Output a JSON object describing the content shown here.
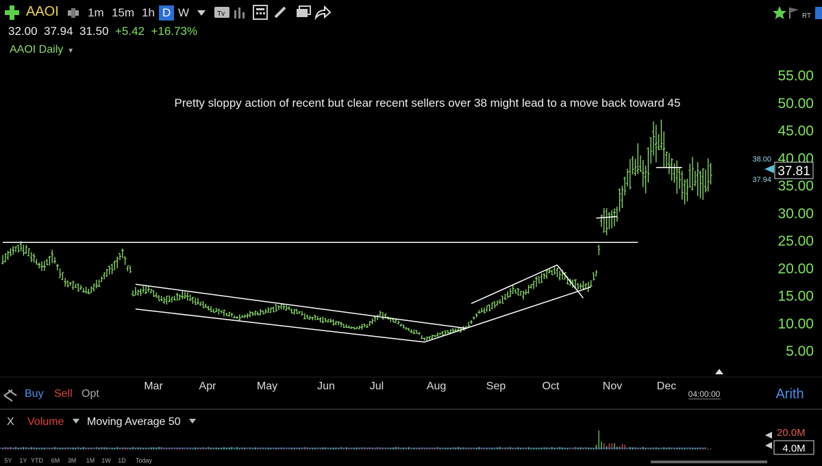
{
  "toolbar": {
    "symbol": "AAOI",
    "intervals": [
      "1m",
      "15m",
      "1h",
      "D",
      "W"
    ],
    "active_interval": "D",
    "rt_label": "RT"
  },
  "quote": {
    "open": "32.00",
    "high": "37.94",
    "low": "31.50",
    "change": "+5.42",
    "change_pct": "+16.73%"
  },
  "chart": {
    "title": "AAOI Daily",
    "annotation": "Pretty sloppy action of recent but clear recent sellers over 38 might lead to a move back toward 45",
    "current_price": "37.81",
    "high_marker": "38.00",
    "close_marker": "37.94",
    "scale_mode": "Arith",
    "time_label": "04:00:00"
  },
  "trade": {
    "buy": "Buy",
    "sell": "Sell",
    "opt": "Opt"
  },
  "volume_panel": {
    "close_label": "X",
    "title": "Volume",
    "indicator": "Moving Average 50",
    "axis": [
      "20.0M",
      "4.0M"
    ]
  },
  "range_buttons": [
    "5Y",
    "1Y",
    "YTD",
    "6M",
    "3M",
    "1M",
    "1W",
    "1D",
    "Today"
  ],
  "colors": {
    "bars": "#8fe36b",
    "axis": "#7ee35b",
    "ticker": "#e8d44d",
    "sell": "#e0403a",
    "buy": "#4a8fe8"
  },
  "chart_data": {
    "type": "ohlc",
    "xlabel": "",
    "ylabel": "",
    "ylim": [
      3,
      57
    ],
    "y_ticks": [
      "55.00",
      "50.00",
      "45.00",
      "40.00",
      "35.00",
      "30.00",
      "25.00",
      "20.00",
      "15.00",
      "10.00",
      "5.00"
    ],
    "x_ticks": [
      "Mar",
      "Apr",
      "May",
      "Jun",
      "Jul",
      "Aug",
      "Sep",
      "Oct",
      "Nov",
      "Dec"
    ],
    "anchors": [
      [
        0,
        21.5
      ],
      [
        3,
        22.5
      ],
      [
        7,
        24.0
      ],
      [
        10,
        22.8
      ],
      [
        15,
        20.0
      ],
      [
        19,
        22.0
      ],
      [
        24,
        17.5
      ],
      [
        29,
        16.5
      ],
      [
        33,
        15.5
      ],
      [
        38,
        18.0
      ],
      [
        43,
        20.5
      ],
      [
        46,
        22.5
      ],
      [
        48,
        20.0
      ],
      [
        49,
        19.5
      ],
      [
        50,
        15.5
      ],
      [
        56,
        16.0
      ],
      [
        62,
        14.0
      ],
      [
        70,
        15.0
      ],
      [
        80,
        12.5
      ],
      [
        90,
        11.0
      ],
      [
        100,
        12.0
      ],
      [
        108,
        13.0
      ],
      [
        118,
        11.0
      ],
      [
        128,
        10.0
      ],
      [
        135,
        9.0
      ],
      [
        140,
        9.5
      ],
      [
        145,
        11.5
      ],
      [
        150,
        10.5
      ],
      [
        155,
        9.0
      ],
      [
        160,
        8.0
      ],
      [
        162,
        7.0
      ],
      [
        168,
        8.0
      ],
      [
        178,
        9.0
      ],
      [
        183,
        12.0
      ],
      [
        190,
        13.5
      ],
      [
        196,
        16.0
      ],
      [
        200,
        15.0
      ],
      [
        205,
        17.5
      ],
      [
        210,
        19.5
      ],
      [
        215,
        18.5
      ],
      [
        220,
        17.0
      ],
      [
        225,
        16.5
      ],
      [
        228,
        19.0
      ],
      [
        230,
        28.0
      ],
      [
        235,
        28.5
      ],
      [
        238,
        33.0
      ],
      [
        242,
        38.5
      ],
      [
        245,
        39.0
      ],
      [
        247,
        37.0
      ],
      [
        250,
        42.5
      ],
      [
        253,
        43.0
      ],
      [
        256,
        38.0
      ],
      [
        259,
        36.0
      ],
      [
        262,
        34.0
      ],
      [
        265,
        37.0
      ],
      [
        268,
        35.0
      ],
      [
        271,
        37.0
      ],
      [
        272,
        37.81
      ]
    ],
    "volume_spike": "Nov",
    "trendlines": [
      {
        "x": [
          0,
          244
        ],
        "y": [
          24.6,
          24.6
        ]
      },
      {
        "x": [
          51,
          178
        ],
        "y": [
          17.0,
          9.0
        ]
      },
      {
        "x": [
          51,
          162
        ],
        "y": [
          12.5,
          6.5
        ]
      },
      {
        "x": [
          180,
          213
        ],
        "y": [
          13.5,
          20.5
        ]
      },
      {
        "x": [
          162,
          226
        ],
        "y": [
          6.5,
          16.5
        ]
      },
      {
        "x": [
          213,
          223
        ],
        "y": [
          20.5,
          14.5
        ]
      },
      {
        "x": [
          228,
          236
        ],
        "y": [
          29.0,
          29.3
        ]
      },
      {
        "x": [
          251,
          261
        ],
        "y": [
          38.2,
          38.2
        ]
      }
    ]
  }
}
